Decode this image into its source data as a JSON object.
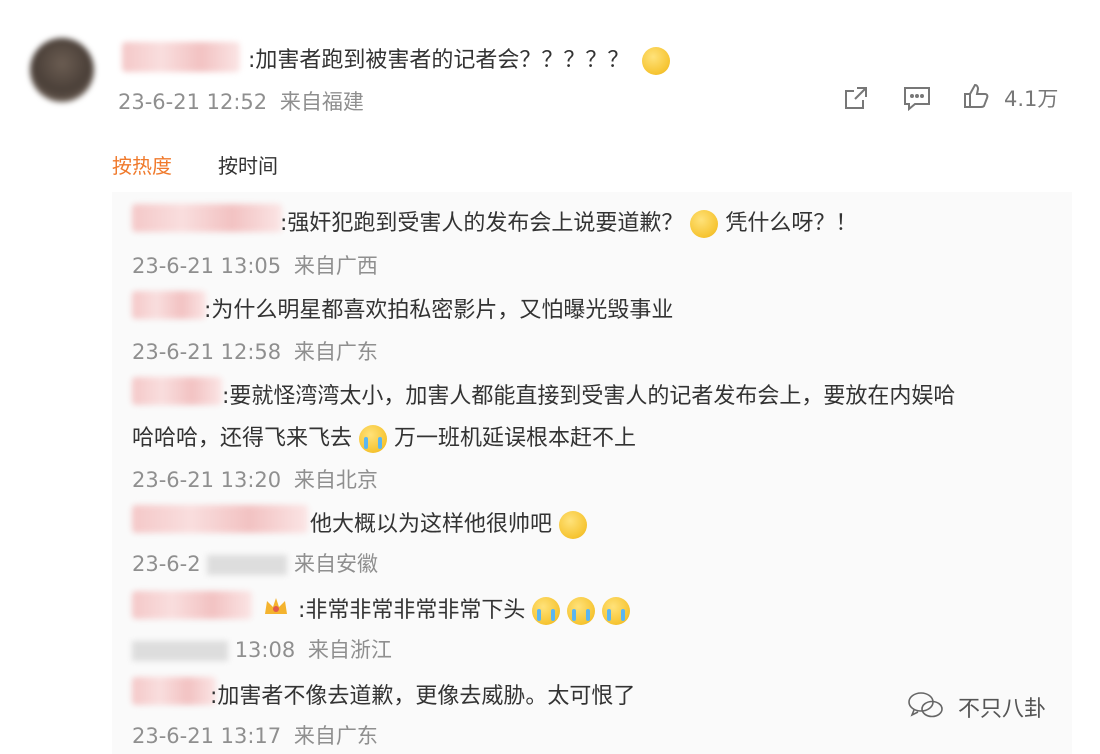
{
  "comment": {
    "text": ":加害者跑到被害者的记者会？？？？？",
    "date": "23-6-21 12:52",
    "location": "来自福建",
    "like_count": "4.1万"
  },
  "sort_tabs": {
    "hot": "按热度",
    "time": "按时间"
  },
  "replies": [
    {
      "text1": ":强奸犯跑到受害人的发布会上说要道歉？",
      "text2": "凭什么呀？！",
      "date": "23-6-21 13:05",
      "location": "来自广西"
    },
    {
      "text1": ":为什么明星都喜欢拍私密影片，又怕曝光毁事业",
      "date": "23-6-21 12:58",
      "location": "来自广东"
    },
    {
      "line1": ":要就怪湾湾太小，加害人都能直接到受害人的记者发布会上，要放在内娱哈",
      "line2a": "哈哈哈，还得飞来飞去",
      "line2b": "万一班机延误根本赶不上",
      "date": "23-6-21 13:20",
      "location": "来自北京"
    },
    {
      "text1": "他大概以为这样他很帅吧",
      "date": "23-6-2",
      "location": "来自安徽"
    },
    {
      "text1": ":非常非常非常非常下头",
      "date": "13:08",
      "location": "来自浙江"
    },
    {
      "text1": ":加害者不像去道歉，更像去威胁。太可恨了",
      "date": "23-6-21 13:17",
      "location": "来自广东"
    }
  ],
  "watermark": "不只八卦",
  "colors": {
    "accent": "#f07a2c",
    "meta": "#8f8f8f",
    "reply_bg": "#fafafa"
  }
}
